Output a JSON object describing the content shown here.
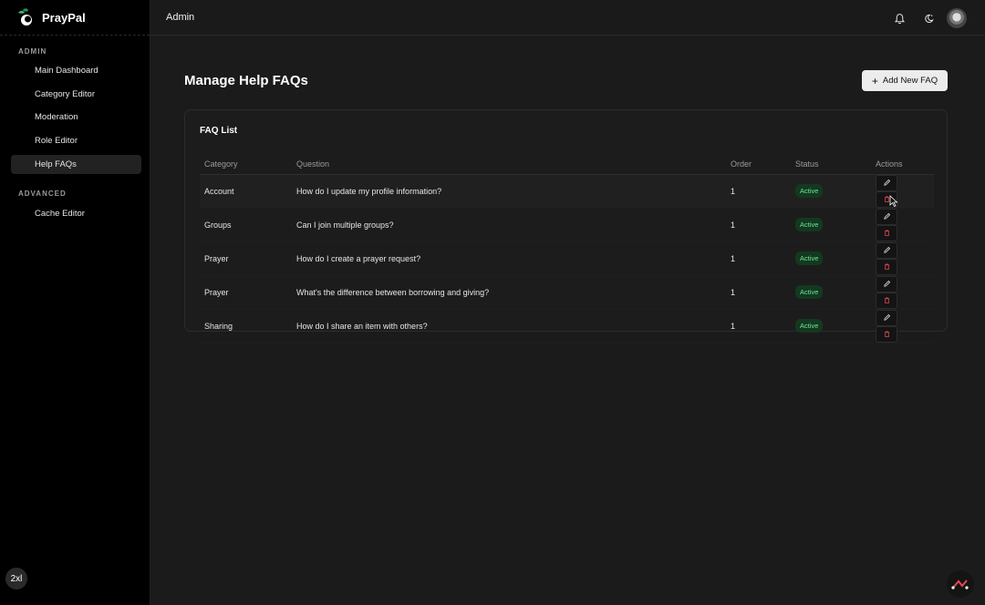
{
  "app": {
    "name": "PrayPal"
  },
  "sidebar": {
    "sections": [
      {
        "label": "ADMIN",
        "items": [
          "Main Dashboard",
          "Category Editor",
          "Moderation",
          "Role Editor",
          "Help FAQs"
        ]
      },
      {
        "label": "ADVANCED",
        "items": [
          "Cache Editor"
        ]
      }
    ],
    "active_item": "Help FAQs",
    "size_badge": "2xl"
  },
  "topbar": {
    "title": "Admin",
    "icons": [
      "bell-icon",
      "theme-toggle-icon",
      "avatar"
    ]
  },
  "page": {
    "title": "Manage Help FAQs",
    "add_button": "Add New FAQ"
  },
  "card": {
    "title": "FAQ List",
    "columns": [
      "Category",
      "Question",
      "Order",
      "Status",
      "Actions"
    ],
    "rows": [
      {
        "category": "Account",
        "question": "How do I update my profile information?",
        "order": "1",
        "status": "Active"
      },
      {
        "category": "Groups",
        "question": "Can I join multiple groups?",
        "order": "1",
        "status": "Active"
      },
      {
        "category": "Prayer",
        "question": "How do I create a prayer request?",
        "order": "1",
        "status": "Active"
      },
      {
        "category": "Prayer",
        "question": "What's the difference between borrowing and giving?",
        "order": "1",
        "status": "Active"
      },
      {
        "category": "Sharing",
        "question": "How do I share an item with others?",
        "order": "1",
        "status": "Active"
      }
    ]
  },
  "colors": {
    "accent_green": "#6fe39a",
    "badge_bg": "#13391f",
    "delete_red": "#e5484d"
  }
}
